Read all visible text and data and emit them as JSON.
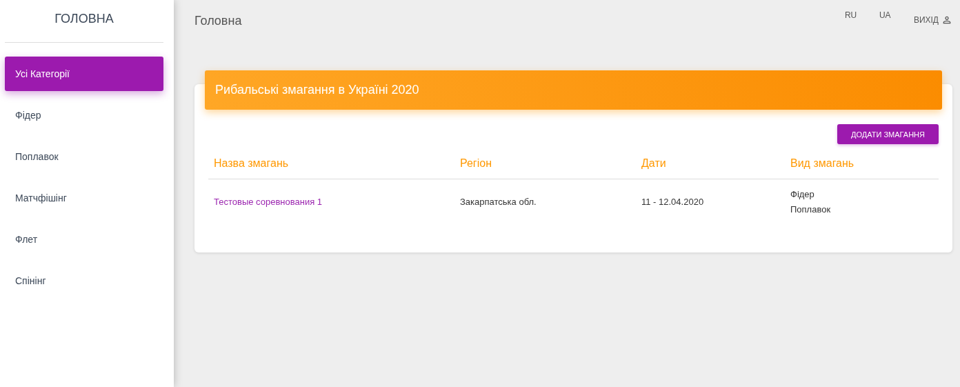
{
  "sidebar": {
    "title": "ГОЛОВНА",
    "items": [
      {
        "label": "Усі Категорії",
        "selected": true
      },
      {
        "label": "Фідер",
        "selected": false
      },
      {
        "label": "Поплавок",
        "selected": false
      },
      {
        "label": "Матчфішінг",
        "selected": false
      },
      {
        "label": "Флет",
        "selected": false
      },
      {
        "label": "Спінінг",
        "selected": false
      }
    ]
  },
  "header": {
    "title": "Головна",
    "languages": [
      "RU",
      "UA"
    ],
    "logout": "ВИХІД"
  },
  "card": {
    "title": "Рибальські змагання в Україні 2020",
    "add_button": "ДОДАТИ ЗМАГАННЯ",
    "table": {
      "columns": [
        "Назва змагань",
        "Регіон",
        "Дати",
        "Вид змагань"
      ],
      "rows": [
        {
          "name": "Тестовые соревнования 1",
          "region": "Закарпатська обл.",
          "dates": "11 - 12.04.2020",
          "types": [
            "Фідер",
            "Поплавок"
          ]
        }
      ]
    }
  }
}
